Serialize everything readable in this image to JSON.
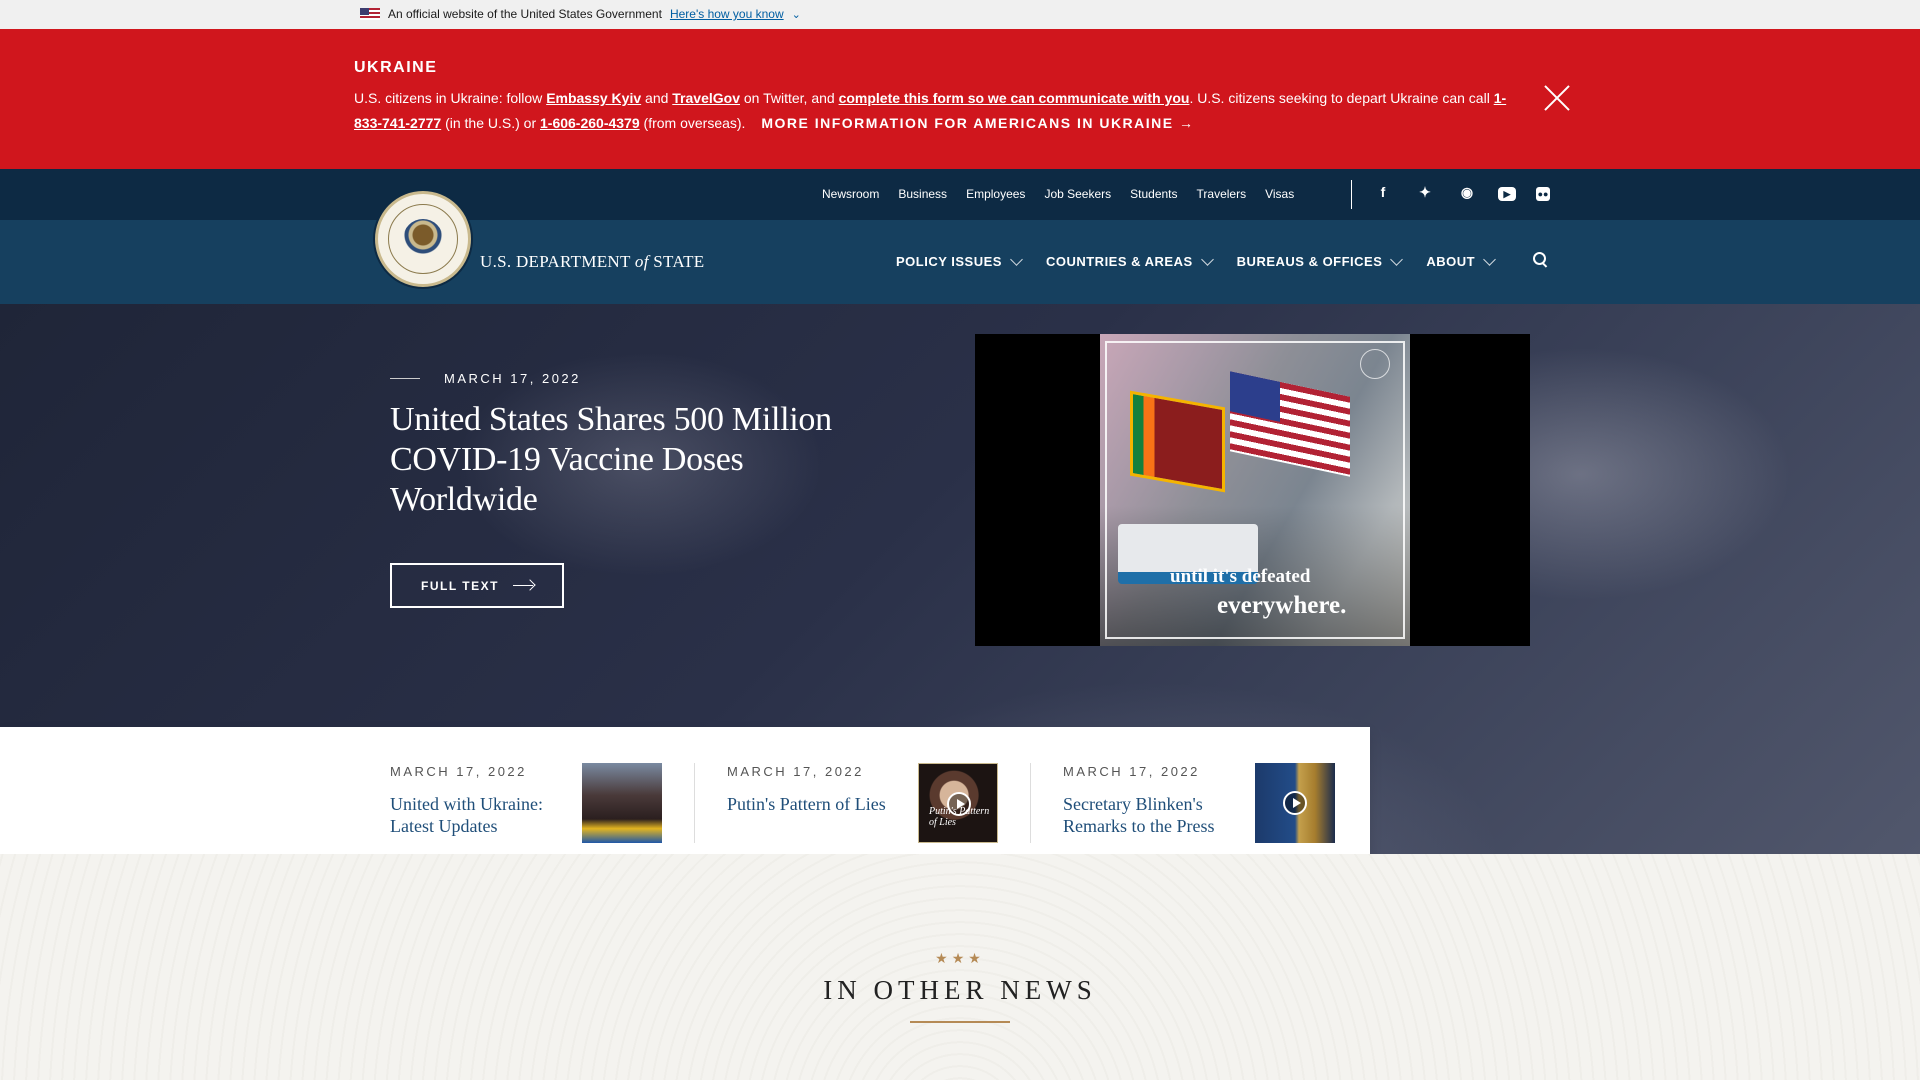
{
  "gov_banner": {
    "text": "An official website of the United States Government",
    "link": "Here's how you know"
  },
  "alert": {
    "title": "UKRAINE",
    "p1": "U.S. citizens in Ukraine: follow ",
    "link_embassy": "Embassy Kyiv",
    "p2": " and ",
    "link_travelgov": "TravelGov",
    "p3": " on Twitter, and ",
    "link_form": "complete this form so we can communicate with you",
    "p4": ". U.S. citizens seeking to depart Ukraine can call ",
    "phone_us": "1-833-741-2777",
    "p5": " (in the U.S.) or ",
    "phone_overseas": "1-606-260-4379",
    "p6": " (from overseas).",
    "more": "MORE INFORMATION FOR AMERICANS IN UKRAINE →"
  },
  "utility_links": [
    "Newsroom",
    "Business",
    "Employees",
    "Job Seekers",
    "Students",
    "Travelers",
    "Visas"
  ],
  "social_icons": [
    "facebook-icon",
    "twitter-icon",
    "instagram-icon",
    "youtube-icon",
    "flickr-icon"
  ],
  "site": {
    "name_pre": "U.S. DEPARTMENT ",
    "name_of": "of",
    "name_post": " STATE"
  },
  "nav": [
    "POLICY ISSUES",
    "COUNTRIES & AREAS",
    "BUREAUS & OFFICES",
    "ABOUT"
  ],
  "hero": {
    "date": "MARCH 17, 2022",
    "title": "United States Shares 500 Million COVID-19 Vaccine Doses Worldwide",
    "button": "FULL TEXT",
    "video_caption_1": "until it's defeated",
    "video_caption_2": "everywhere."
  },
  "cards": [
    {
      "date": "MARCH 17, 2022",
      "title": "United with Ukraine: Latest Updates"
    },
    {
      "date": "MARCH 17, 2022",
      "title": "Putin's Pattern of Lies",
      "thumb_text": "Putin's Pattern of Lies"
    },
    {
      "date": "MARCH 17, 2022",
      "title": "Secretary Blinken's Remarks to the Press"
    }
  ],
  "other_news": {
    "stars": "★★★",
    "title": "IN OTHER NEWS"
  }
}
